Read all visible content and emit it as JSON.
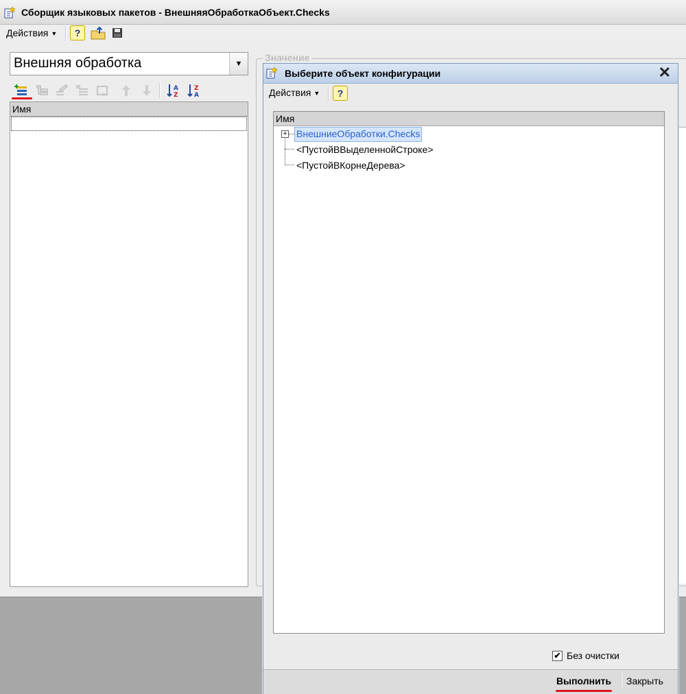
{
  "main_window": {
    "title": "Сборщик языковых пакетов - ВнешняяОбработкаОбъект.Checks",
    "toolbar": {
      "actions_label": "Действия",
      "help_label": "?",
      "icons": [
        "help-icon",
        "upload-folder-icon",
        "save-floppy-icon"
      ]
    },
    "type_combo": {
      "value": "Внешняя обработка"
    },
    "list_toolbar": {
      "buttons": [
        {
          "name": "add-item-icon",
          "enabled": true,
          "highlighted": true
        },
        {
          "name": "add-subitem-icon",
          "enabled": false
        },
        {
          "name": "edit-item-icon",
          "enabled": false
        },
        {
          "name": "delete-item-icon",
          "enabled": false
        },
        {
          "name": "ok-item-icon",
          "enabled": false
        },
        {
          "name": "move-up-icon",
          "enabled": false
        },
        {
          "name": "move-down-icon",
          "enabled": false
        },
        {
          "name": "sort-asc-icon",
          "enabled": true
        },
        {
          "name": "sort-desc-icon",
          "enabled": true
        }
      ]
    },
    "list": {
      "column_header": "Имя"
    },
    "value_group": {
      "label": "Значение"
    }
  },
  "dialog": {
    "title": "Выберите объект конфигурации",
    "toolbar": {
      "actions_label": "Действия",
      "help_label": "?"
    },
    "tree": {
      "column_header": "Имя",
      "rows": [
        {
          "label": "ВнешниеОбработки.Checks",
          "expandable": true,
          "selected": true
        },
        {
          "label": "<ПустойВВыделеннойСтроке>",
          "expandable": false,
          "selected": false
        },
        {
          "label": "<ПустойВКорнеДерева>",
          "expandable": false,
          "selected": false
        }
      ]
    },
    "no_clear_checkbox": {
      "label": "Без очистки",
      "checked": true,
      "mark": "✔"
    },
    "buttons": {
      "execute": "Выполнить",
      "close": "Закрыть"
    },
    "close_glyph": "✕"
  },
  "colors": {
    "highlight_underline": "#e0141e",
    "selection_text": "#2a62c9",
    "dialog_title_bg": "#c9d9ee"
  }
}
